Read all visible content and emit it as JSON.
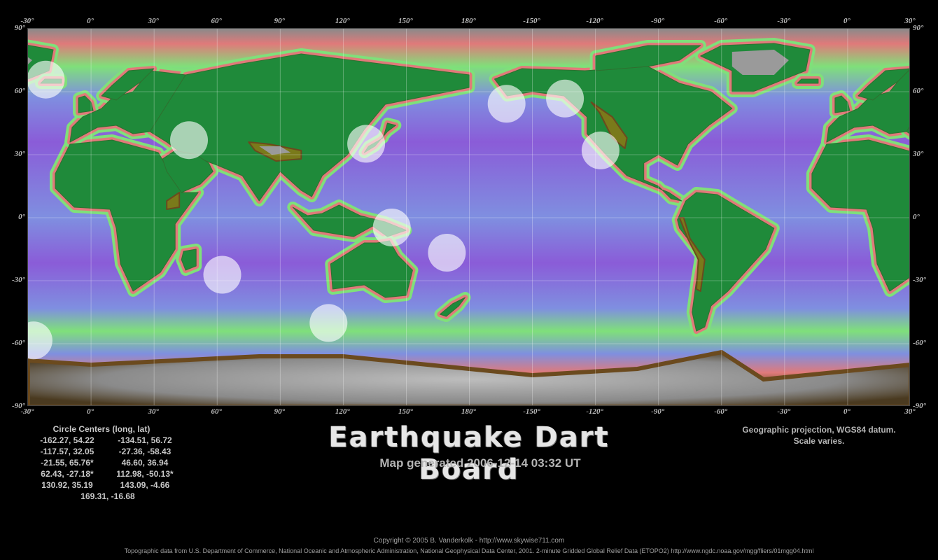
{
  "map": {
    "projection_note": [
      "Geographic projection, WGS84 datum.",
      "Scale varies."
    ],
    "top_lon_labels": [
      "-30°",
      "0°",
      "30°",
      "60°",
      "90°",
      "120°",
      "150°",
      "180°",
      "-150°",
      "-120°",
      "-90°",
      "-60°",
      "-30°",
      "0°",
      "30°"
    ],
    "bottom_lon_labels": [
      "-30°",
      "0°",
      "30°",
      "60°",
      "90°",
      "120°",
      "150°",
      "180°",
      "-150°",
      "-120°",
      "-90°",
      "-60°",
      "-30°",
      "0°",
      "30°"
    ],
    "lat_labels": [
      "90°",
      "60°",
      "30°",
      "0°",
      "-30°",
      "-60°",
      "-90°"
    ],
    "circle_markers": [
      {
        "lon": -162.27,
        "lat": 54.22
      },
      {
        "lon": -134.51,
        "lat": 56.72
      },
      {
        "lon": -117.57,
        "lat": 32.05
      },
      {
        "lon": -27.36,
        "lat": -58.43
      },
      {
        "lon": -21.55,
        "lat": 65.76
      },
      {
        "lon": 46.6,
        "lat": 36.94
      },
      {
        "lon": 62.43,
        "lat": -27.18
      },
      {
        "lon": 112.98,
        "lat": -50.13
      },
      {
        "lon": 130.92,
        "lat": 35.19
      },
      {
        "lon": 143.09,
        "lat": -4.66
      },
      {
        "lon": 169.31,
        "lat": -16.68
      }
    ],
    "colors": {
      "ocean_deep": "#8a5cd8",
      "ocean_mid": "#7f8fe0",
      "ocean_shelf": "#7fe07a",
      "coast": "#e07a7a",
      "lowland": "#1f8a3a",
      "upland": "#7a7a1a",
      "high": "#6b4a1e",
      "ice": "#9a9a9a",
      "marker": "#ffffff"
    }
  },
  "circle_centers": {
    "header": "Circle Centers (long, lat)",
    "rows": [
      [
        "-162.27,  54.22",
        "-134.51,  56.72"
      ],
      [
        "-117.57,  32.05",
        "-27.36,  -58.43"
      ],
      [
        "-21.55,  65.76*",
        "46.60,  36.94"
      ],
      [
        "62.43,  -27.18*",
        "112.98,  -50.13*"
      ],
      [
        "130.92,  35.19",
        "143.09,  -4.66"
      ]
    ],
    "last": "169.31,  -16.68"
  },
  "title": "Earthquake Dart Board",
  "subtitle": "Map generated 2006-12-14 03:32 UT",
  "copyright": "Copyright © 2005 B. Vanderkolk - http://www.skywise711.com",
  "source": "Topographic data from U.S. Department of Commerce, National Oceanic and Atmospheric Administration, National Geophysical Data Center, 2001. 2-minute Gridded Global Relief Data (ETOPO2) http://www.ngdc.noaa.gov/mgg/fliers/01mgg04.html"
}
